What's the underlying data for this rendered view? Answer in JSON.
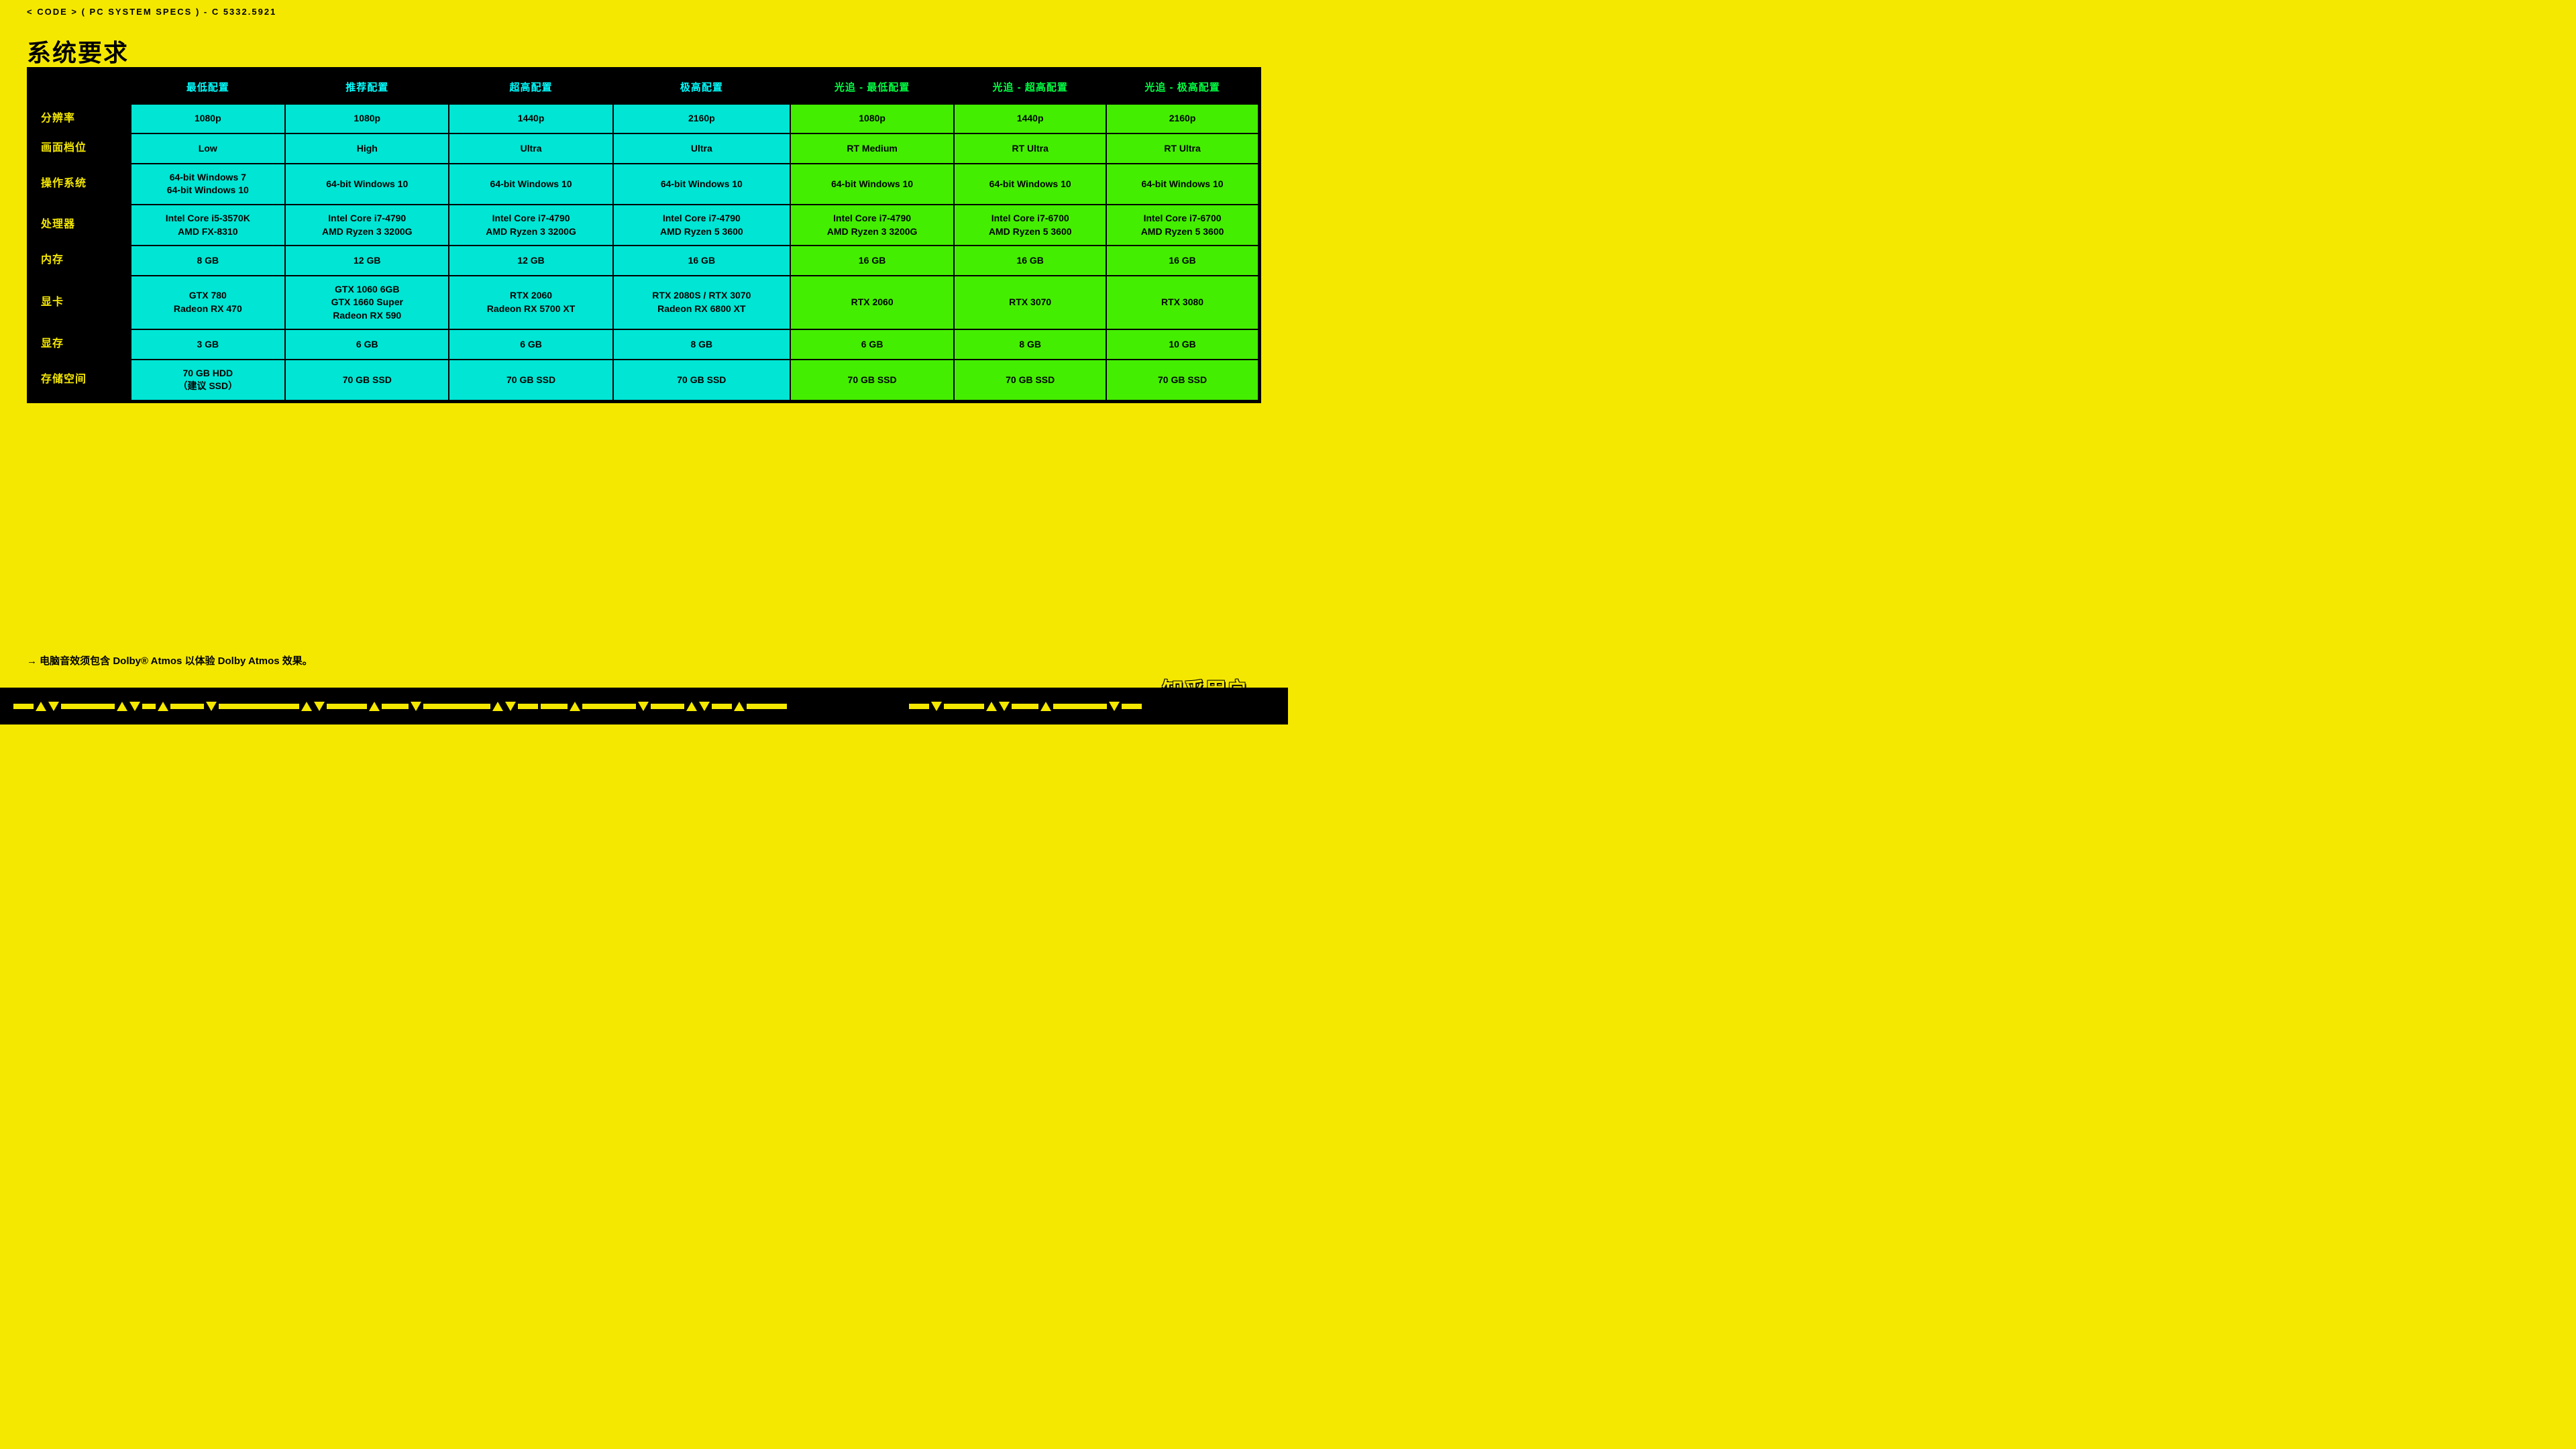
{
  "topbar": {
    "text": "< CODE > ( PC SYSTEM SPECS ) - C 5332.5921"
  },
  "page": {
    "title": "系统要求"
  },
  "table": {
    "headers": [
      {
        "label": "",
        "class": "row-label-header"
      },
      {
        "label": "最低配置",
        "class": ""
      },
      {
        "label": "推荐配置",
        "class": ""
      },
      {
        "label": "超高配置",
        "class": ""
      },
      {
        "label": "极高配置",
        "class": ""
      },
      {
        "label": "光追 - 最低配置",
        "class": "rt-header"
      },
      {
        "label": "光追 - 超高配置",
        "class": "rt-header"
      },
      {
        "label": "光追 - 极高配置",
        "class": "rt-header"
      }
    ],
    "rows": [
      {
        "label": "分辨率",
        "cells": [
          {
            "value": "1080p",
            "class": ""
          },
          {
            "value": "1080p",
            "class": ""
          },
          {
            "value": "1440p",
            "class": ""
          },
          {
            "value": "2160p",
            "class": ""
          },
          {
            "value": "1080p",
            "class": "rt-cell"
          },
          {
            "value": "1440p",
            "class": "rt-cell"
          },
          {
            "value": "2160p",
            "class": "rt-cell"
          }
        ]
      },
      {
        "label": "画面档位",
        "cells": [
          {
            "value": "Low",
            "class": ""
          },
          {
            "value": "High",
            "class": ""
          },
          {
            "value": "Ultra",
            "class": ""
          },
          {
            "value": "Ultra",
            "class": ""
          },
          {
            "value": "RT Medium",
            "class": "rt-cell"
          },
          {
            "value": "RT Ultra",
            "class": "rt-cell"
          },
          {
            "value": "RT Ultra",
            "class": "rt-cell"
          }
        ]
      },
      {
        "label": "操作系统",
        "cells": [
          {
            "value": "64-bit Windows 7\n64-bit Windows 10",
            "class": ""
          },
          {
            "value": "64-bit Windows 10",
            "class": ""
          },
          {
            "value": "64-bit Windows 10",
            "class": ""
          },
          {
            "value": "64-bit Windows 10",
            "class": ""
          },
          {
            "value": "64-bit Windows 10",
            "class": "rt-cell"
          },
          {
            "value": "64-bit Windows 10",
            "class": "rt-cell"
          },
          {
            "value": "64-bit Windows 10",
            "class": "rt-cell"
          }
        ]
      },
      {
        "label": "处理器",
        "cells": [
          {
            "value": "Intel Core i5-3570K\nAMD FX-8310",
            "class": ""
          },
          {
            "value": "Intel Core i7-4790\nAMD Ryzen 3 3200G",
            "class": ""
          },
          {
            "value": "Intel Core i7-4790\nAMD Ryzen 3 3200G",
            "class": ""
          },
          {
            "value": "Intel Core i7-4790\nAMD Ryzen 5 3600",
            "class": ""
          },
          {
            "value": "Intel Core i7-4790\nAMD Ryzen 3 3200G",
            "class": "rt-cell"
          },
          {
            "value": "Intel Core i7-6700\nAMD Ryzen 5 3600",
            "class": "rt-cell"
          },
          {
            "value": "Intel Core i7-6700\nAMD Ryzen 5 3600",
            "class": "rt-cell"
          }
        ]
      },
      {
        "label": "内存",
        "cells": [
          {
            "value": "8 GB",
            "class": ""
          },
          {
            "value": "12 GB",
            "class": ""
          },
          {
            "value": "12 GB",
            "class": ""
          },
          {
            "value": "16 GB",
            "class": ""
          },
          {
            "value": "16 GB",
            "class": "rt-cell"
          },
          {
            "value": "16 GB",
            "class": "rt-cell"
          },
          {
            "value": "16 GB",
            "class": "rt-cell"
          }
        ]
      },
      {
        "label": "显卡",
        "cells": [
          {
            "value": "GTX 780\nRadeon RX 470",
            "class": ""
          },
          {
            "value": "GTX 1060 6GB\nGTX 1660 Super\nRadeon RX 590",
            "class": ""
          },
          {
            "value": "RTX 2060\nRadeon RX 5700 XT",
            "class": ""
          },
          {
            "value": "RTX 2080S / RTX 3070\nRadeon RX 6800 XT",
            "class": ""
          },
          {
            "value": "RTX 2060",
            "class": "rt-cell"
          },
          {
            "value": "RTX 3070",
            "class": "rt-cell"
          },
          {
            "value": "RTX 3080",
            "class": "rt-cell"
          }
        ]
      },
      {
        "label": "显存",
        "cells": [
          {
            "value": "3 GB",
            "class": ""
          },
          {
            "value": "6 GB",
            "class": ""
          },
          {
            "value": "6 GB",
            "class": ""
          },
          {
            "value": "8 GB",
            "class": ""
          },
          {
            "value": "6 GB",
            "class": "rt-cell"
          },
          {
            "value": "8 GB",
            "class": "rt-cell"
          },
          {
            "value": "10 GB",
            "class": "rt-cell"
          }
        ]
      },
      {
        "label": "存储空间",
        "cells": [
          {
            "value": "70 GB HDD\n（建议 SSD）",
            "class": ""
          },
          {
            "value": "70 GB SSD",
            "class": ""
          },
          {
            "value": "70 GB SSD",
            "class": ""
          },
          {
            "value": "70 GB SSD",
            "class": ""
          },
          {
            "value": "70 GB SSD",
            "class": "rt-cell"
          },
          {
            "value": "70 GB SSD",
            "class": "rt-cell"
          },
          {
            "value": "70 GB SSD",
            "class": "rt-cell"
          }
        ]
      }
    ]
  },
  "footnote": {
    "text": "→ 电脑音效须包含 Dolby® Atmos 以体验 Dolby Atmos 效果。"
  },
  "watermark": {
    "text": "知乎用户"
  }
}
